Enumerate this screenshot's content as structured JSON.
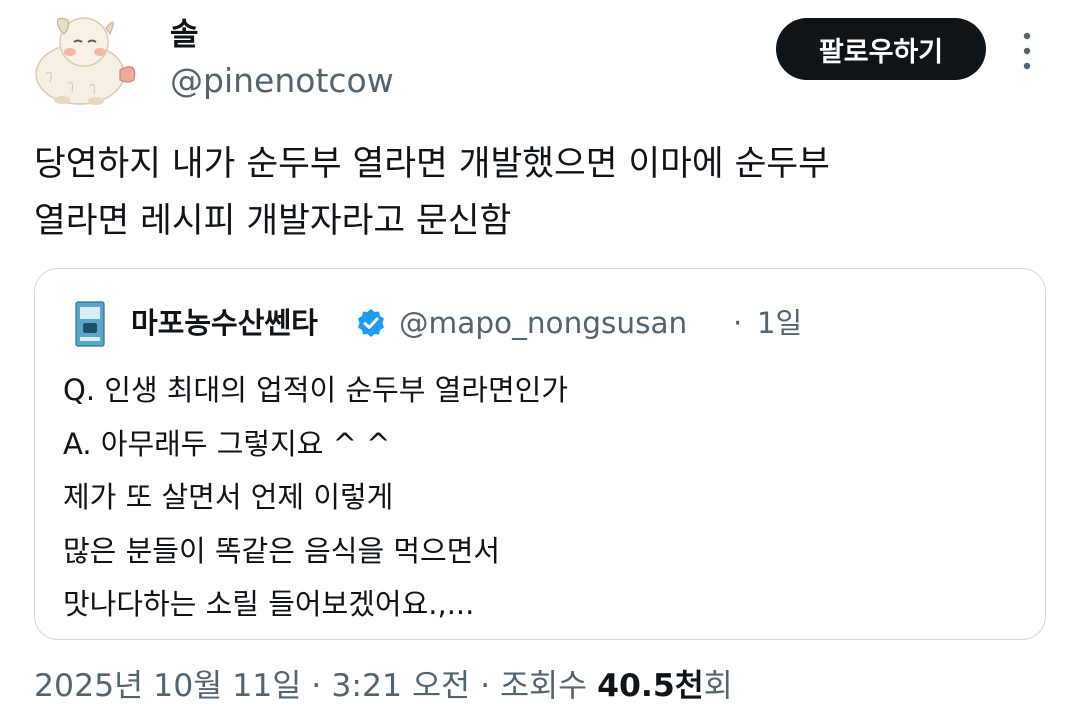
{
  "author": {
    "name": "솔",
    "handle": "@pinenotcow",
    "avatar_icon": "plush-creature-avatar"
  },
  "follow_button": {
    "label": "팔로우하기"
  },
  "more_menu": {
    "icon": "vertical-ellipsis-icon"
  },
  "tweet": {
    "text": "당연하지 내가 순두부 열라면 개발했으면 이마에 순두부\n열라면 레시피 개발자라고 문신함"
  },
  "quote": {
    "author_name": "마포농수산쎈타",
    "verified": true,
    "verified_color": "#1d9bf0",
    "handle": "@mapo_nongsusan",
    "separator": "·",
    "time": "1일",
    "lines": [
      "Q. 인생 최대의 업적이 순두부 열라면인가",
      "A. 아무래두 그렇지요 ^ ^",
      "제가 또 살면서 언제 이렇게",
      "많은 분들이 똑같은 음식을 먹으면서",
      "맛나다하는 소릴 들어보겠어요.,..."
    ]
  },
  "meta": {
    "date": "2025년 10월 11일",
    "sep1": " · ",
    "time": "3:21 오전",
    "sep2": " · ",
    "views_label": "조회수 ",
    "views_count": "40.5천",
    "views_suffix": "회"
  },
  "colors": {
    "text_primary": "#0f1419",
    "text_secondary": "#536471",
    "border": "#cfd9de",
    "follow_bg": "#0f1419"
  }
}
